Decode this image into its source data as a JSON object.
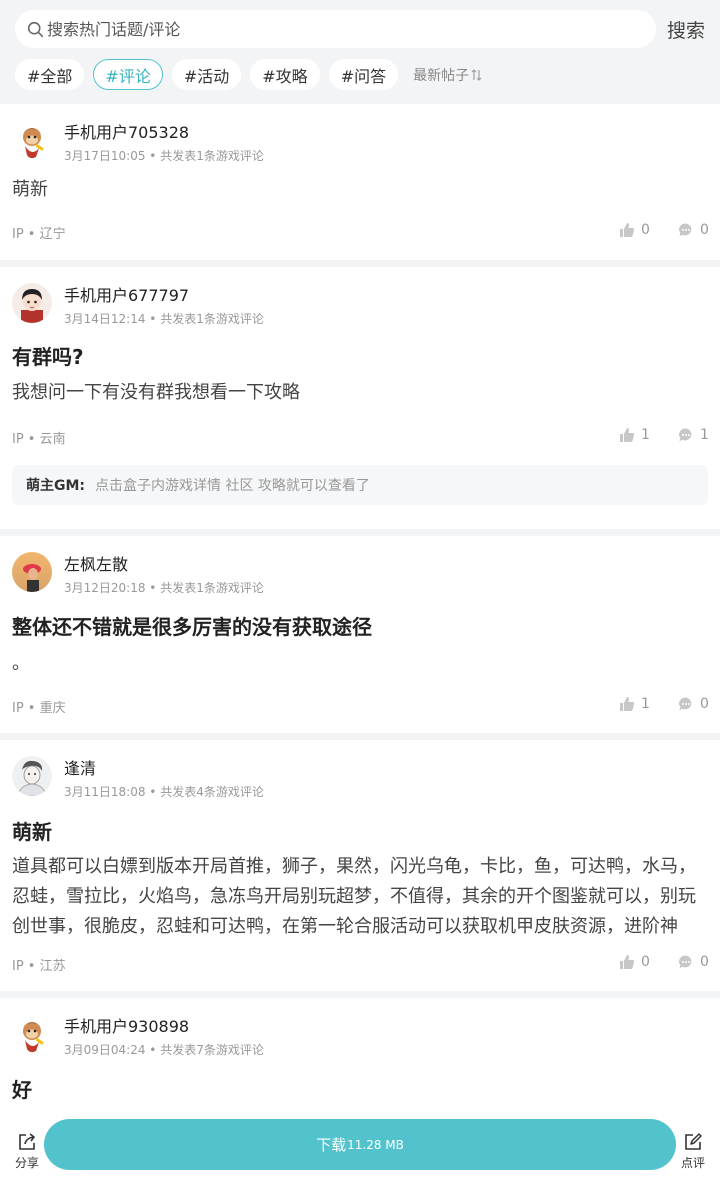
{
  "search": {
    "placeholder": "搜索热门话题/评论",
    "button": "搜索"
  },
  "tabs": [
    "#全部",
    "#评论",
    "#活动",
    "#攻略",
    "#问答"
  ],
  "active_tab": "#评论",
  "sort_label": "最新帖子",
  "colors": {
    "accent": "#52c3cc",
    "background": "#f3f4f6"
  },
  "posts": [
    {
      "user": "手机用户705328",
      "meta": "3月17日10:05 • 共发表1条游戏评论",
      "title": "",
      "body": "萌新",
      "ip": "IP • 辽宁",
      "likes": "0",
      "comments": "0",
      "avatar": "cartoon-monkey-avatar"
    },
    {
      "user": "手机用户677797",
      "meta": "3月14日12:14 • 共发表1条游戏评论",
      "title": "有群吗?",
      "body": "我想问一下有没有群我想看一下攻略",
      "ip": "IP • 云南",
      "likes": "1",
      "comments": "1",
      "avatar": "cartoon-boy-avatar",
      "reply": {
        "author": "萌主GM:",
        "text": "点击盒子内游戏详情 社区 攻略就可以查看了"
      }
    },
    {
      "user": "左枫左散",
      "meta": "3月12日20:18 • 共发表1条游戏评论",
      "title": "整体还不错就是很多厉害的没有获取途径",
      "body": "。",
      "ip": "IP • 重庆",
      "likes": "1",
      "comments": "0",
      "avatar": "photo-avatar"
    },
    {
      "user": "逢清",
      "meta": "3月11日18:08 • 共发表4条游戏评论",
      "title": "萌新",
      "body": "道具都可以白嫖到版本开局首推，狮子，果然，闪光乌龟，卡比，鱼，可达鸭，水马，忍蛙，雪拉比，火焰鸟，急冻鸟开局别玩超梦，不值得，其余的开个图鉴就可以，别玩创世事，很脆皮，忍蛙和可达鸭，在第一轮合服活动可以获取机甲皮肤资源，进阶神话。版...",
      "ip": "IP • 江苏",
      "likes": "0",
      "comments": "0",
      "avatar": "sketch-avatar"
    },
    {
      "user": "手机用户930898",
      "meta": "3月09日04:24 • 共发表7条游戏评论",
      "title": "好",
      "body": "",
      "ip": "",
      "likes": "",
      "comments": "",
      "avatar": "cartoon-monkey-avatar"
    }
  ],
  "bottom": {
    "share": "分享",
    "download": "下载",
    "size": "11.28 MB",
    "review": "点评"
  }
}
